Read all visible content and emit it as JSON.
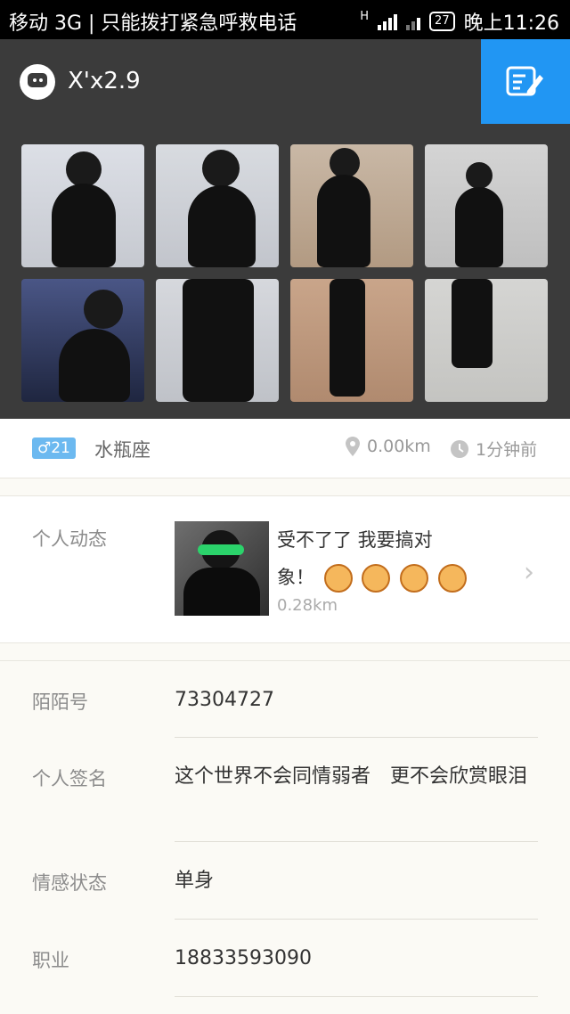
{
  "status_bar": {
    "carrier_text": "移动 3G | 只能拨打紧急呼救电话",
    "network_type": "H",
    "battery": "27",
    "time": "晚上11:26"
  },
  "header": {
    "title": "X'x2.9",
    "app_icon": "chat-bubble-icon",
    "edit_icon": "edit-profile-icon",
    "accent_color": "#2196f3"
  },
  "photos": [
    {
      "name": "photo-1"
    },
    {
      "name": "photo-2"
    },
    {
      "name": "photo-3"
    },
    {
      "name": "photo-4"
    },
    {
      "name": "photo-5"
    },
    {
      "name": "photo-6"
    },
    {
      "name": "photo-7"
    },
    {
      "name": "photo-8"
    }
  ],
  "profile": {
    "gender_age": "♂21",
    "zodiac": "水瓶座",
    "distance": "0.00km",
    "last_active": "1分钟前",
    "badge_color": "#6cb9f0"
  },
  "feed": {
    "label": "个人动态",
    "text_line1": "受不了了 我要搞对",
    "text_line2": "象！",
    "distance": "0.28km",
    "arrow": "›"
  },
  "details": [
    {
      "key": "陌陌号",
      "value": "73304727"
    },
    {
      "key": "个人签名",
      "value": "这个世界不会同情弱者　更不会欣赏眼泪"
    },
    {
      "key": "情感状态",
      "value": "单身"
    },
    {
      "key": "职业",
      "value": "18833593090"
    }
  ]
}
